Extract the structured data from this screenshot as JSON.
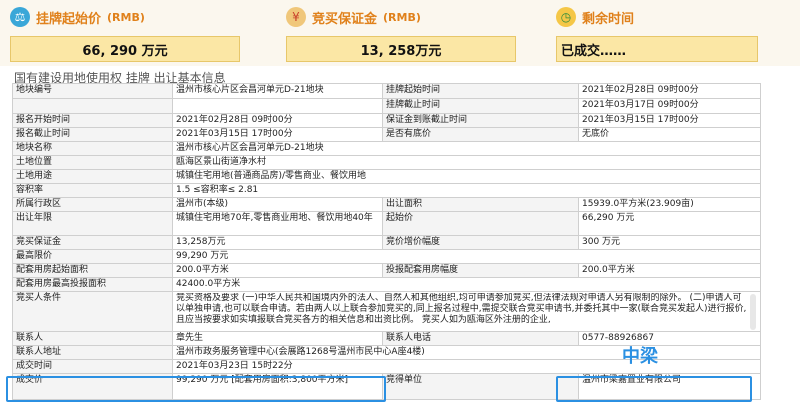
{
  "header": {
    "kpi_1_label": "挂牌起始价",
    "kpi_1_unit": "(RMB)",
    "kpi_1_value": "66, 290  万元",
    "kpi_2_label": "竞买保证金",
    "kpi_2_unit": "(RMB)",
    "kpi_2_value": "13, 258万元",
    "kpi_3_label": "剩余时间",
    "kpi_3_value": "已成交……"
  },
  "section_title": "国有建设用地使用权 挂牌 出让基本信息",
  "rows": {
    "r1": {
      "l1": "地块编号",
      "v1": "温州市核心片区会昌河单元D-21地块",
      "l2": "挂牌起始时间",
      "v2": "2021年02月28日 09时00分"
    },
    "r1b": {
      "l2": "挂牌截止时间",
      "v2": "2021年03月17日 09时00分"
    },
    "r2": {
      "l1": "报名开始时间",
      "v1": "2021年02月28日 09时00分",
      "l2": "保证金到账截止时间",
      "v2": "2021年03月15日 17时00分"
    },
    "r3": {
      "l1": "报名截止时间",
      "v1": "2021年03月15日 17时00分",
      "l2": "是否有底价",
      "v2": "无底价"
    },
    "r4": {
      "l1": "地块名称",
      "v1": "温州市核心片区会昌河单元D-21地块"
    },
    "r5": {
      "l1": "土地位置",
      "v1": "瓯海区景山街道净水村"
    },
    "r6": {
      "l1": "土地用途",
      "v1": "城镇住宅用地(普通商品房)/零售商业、餐饮用地"
    },
    "r7": {
      "l1": "容积率",
      "v1": "1.5 ≤容积率≤ 2.81"
    },
    "r8": {
      "l1": "所属行政区",
      "v1": "温州市(本级)",
      "l2": "出让面积",
      "v2": "15939.0平方米(23.909亩)"
    },
    "r9": {
      "l1": "出让年限",
      "v1": "城镇住宅用地70年,零售商业用地、餐饮用地40年",
      "l2": "起始价",
      "v2": "66,290 万元"
    },
    "r10": {
      "l1": "竞买保证金",
      "v1": "13,258万元",
      "l2": "竞价增价幅度",
      "v2": "300 万元"
    },
    "r11": {
      "l1": "最高限价",
      "v1": "99,290 万元"
    },
    "r12": {
      "l1": "配套用房起始面积",
      "v1": "200.0平方米",
      "l2": "投报配套用房幅度",
      "v2": "200.0平方米"
    },
    "r13": {
      "l1": "配套用房最高投报面积",
      "v1": "42400.0平方米"
    },
    "r14": {
      "l1": "竞买人条件",
      "v1": "竞买资格及要求 (一)中华人民共和国境内外的法人、自然人和其他组织,均可申请参加竞买,但法律法规对申请人另有限制的除外。 (二)申请人可以单独申请,也可以联合申请。若由两人以上联合参加竞买的,同上报名过程中,需提交联合竞买申请书,并委托其中一家(联合竞买发起人)进行报价,且应当按要求如实填报联合竞买各方的相关信息和出资比例。 竞买人如为瓯海区外注册的企业,"
    },
    "r15": {
      "l1": "联系人",
      "v1": "章先生",
      "l2": "联系人电话",
      "v2": "0577-88926867"
    },
    "r16": {
      "l1": "联系人地址",
      "v1": "温州市政务服务管理中心(会展路1268号温州市民中心A座4楼)"
    },
    "r17": {
      "l1": "成交时间",
      "v1": "2021年03月23日 15时22分"
    },
    "r18": {
      "l1": "成交价",
      "v1": "99,290 万元 [配套用房面积:3,800平方米]",
      "l2": "竞得单位",
      "v2": "温州市梁嘉置业有限公司"
    }
  },
  "annotation": "中梁",
  "colors": {
    "accent_orange": "#e0811b",
    "value_box": "#fbe7a5",
    "highlight_blue": "#2b90e2"
  },
  "icons": [
    "gavel-icon",
    "money-bag-icon",
    "clock-icon"
  ]
}
